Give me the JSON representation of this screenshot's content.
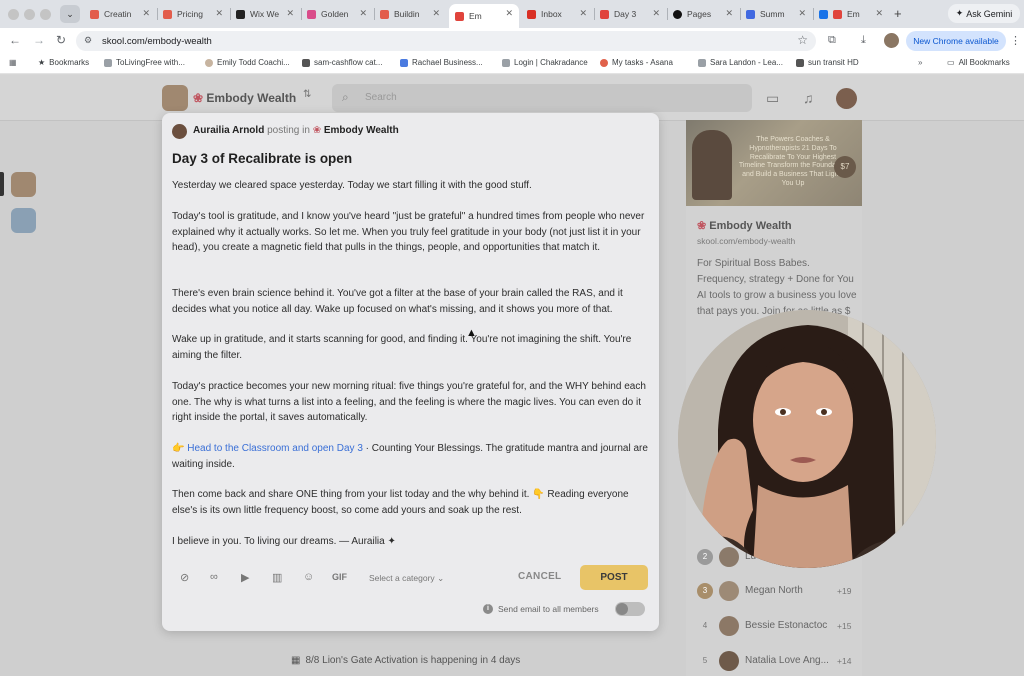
{
  "browser": {
    "tabs": [
      {
        "label": "Creatin",
        "color": "#e25d4c"
      },
      {
        "label": "Pricing",
        "color": "#e25d4c"
      },
      {
        "label": "Wix We",
        "color": "#222222"
      },
      {
        "label": "Golden",
        "color": "#d94c8a"
      },
      {
        "label": "Buildin",
        "color": "#e25d4c"
      },
      {
        "label": "Em",
        "color": "#e0443c"
      },
      {
        "label": "Inbox",
        "color": "#d93025"
      },
      {
        "label": "Day 3",
        "color": "#e0443c"
      },
      {
        "label": "Pages",
        "color": "#111111"
      },
      {
        "label": "Summ",
        "color": "#4169e1"
      },
      {
        "label": "Em",
        "color": "#1a73e8"
      }
    ],
    "ask_gemini": "Ask Gemini",
    "url": "skool.com/embody-wealth",
    "new_chrome": "New Chrome available",
    "bookmarks": [
      "Bookmarks",
      "ToLivingFree with...",
      "Emily Todd Coachi...",
      "sam-cashflow cat...",
      "Rachael Business...",
      "Login | Chakradance",
      "My tasks - Asana",
      "Sara Landon - Lea...",
      "sun transit HD"
    ],
    "all_bookmarks": "All Bookmarks"
  },
  "header": {
    "group_name": "Embody Wealth",
    "search_placeholder": "Search"
  },
  "right_panel": {
    "banner_text": "The Powers Coaches & Hypnotherapists 21 Days To Recalibrate To Your Highest Timeline Transform the Foundation and Build a Business That Lights You Up",
    "banner_price": "$7",
    "group_name": "Embody Wealth",
    "group_url": "skool.com/embody-wealth",
    "description": "For Spiritual Boss Babes. Frequency, strategy + Done for You AI tools to grow a business you love that pays you. Join for as little as $",
    "leaderboard": [
      {
        "rank": "2",
        "name": "Lu",
        "points": ""
      },
      {
        "rank": "3",
        "name": "Megan North",
        "points": "+19"
      },
      {
        "rank": "4",
        "name": "Bessie Estonactoc",
        "points": "+15"
      },
      {
        "rank": "5",
        "name": "Natalia Love Ang...",
        "points": "+14"
      }
    ]
  },
  "event": {
    "text": "8/8 Lion's Gate Activation is happening in 4 days"
  },
  "post": {
    "author": "Aurailia Arnold",
    "posting_in": "posting in",
    "group": "Embody Wealth",
    "title": "Day 3 of Recalibrate is open",
    "p1": "Yesterday we cleared space yesterday. Today we start filling it with the good stuff.",
    "p2": "Today's tool is gratitude, and I know you've heard \"just be grateful\" a hundred times from people who never explained why it actually works. So let me. When you truly feel gratitude in your body (not just list it in your head), you create a magnetic field that pulls in the things, people, and opportunities that match it.",
    "p3": "There's even brain science behind it. You've got a filter at the base of your brain called the RAS, and it decides what you notice all day. Wake up focused on what's missing, and it shows you more of that.",
    "p4": "Wake up in gratitude, and it starts scanning for good, and finding it. You're not imagining the shift. You're aiming the filter.",
    "p5": "Today's practice becomes your new morning ritual: five things you're grateful for, and the WHY behind each one. The why is what turns a list into a feeling, and the feeling is where the magic lives. You can even do it right inside the portal, it saves automatically.",
    "p6_link": "Head to the Classroom and open Day 3",
    "p6_rest": " · Counting Your Blessings. The gratitude mantra and journal are waiting inside.",
    "p7": "Then come back and share ONE thing from your list today and the why behind it. 👇 Reading everyone else's is its own little frequency boost, so come add yours and soak up the rest.",
    "p8": "I believe in you. To living our dreams. — Aurailia ✦",
    "gif_label": "GIF",
    "category_label": "Select a category",
    "cancel_label": "CANCEL",
    "post_label": "POST",
    "email_label": "Send email to all members"
  }
}
